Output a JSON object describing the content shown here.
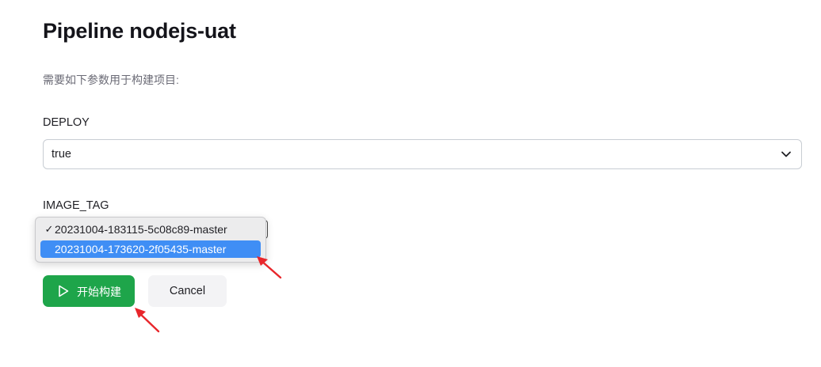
{
  "page": {
    "title": "Pipeline nodejs-uat",
    "description": "需要如下参数用于构建项目:"
  },
  "params": {
    "deploy": {
      "label": "DEPLOY",
      "value": "true"
    },
    "image_tag": {
      "label": "IMAGE_TAG",
      "options": [
        {
          "label": "20231004-183115-5c08c89-master",
          "checked": true
        },
        {
          "label": "20231004-173620-2f05435-master",
          "highlighted": true
        }
      ],
      "check_mark": "✓"
    }
  },
  "actions": {
    "build_label": "开始构建",
    "cancel_label": "Cancel"
  },
  "colors": {
    "primary": "#1ea54a",
    "highlight": "#3f8ef5",
    "annotation_arrow": "#e8262b"
  },
  "icons": {
    "deploy_select": "chevron-down-icon",
    "build": "play-icon"
  }
}
